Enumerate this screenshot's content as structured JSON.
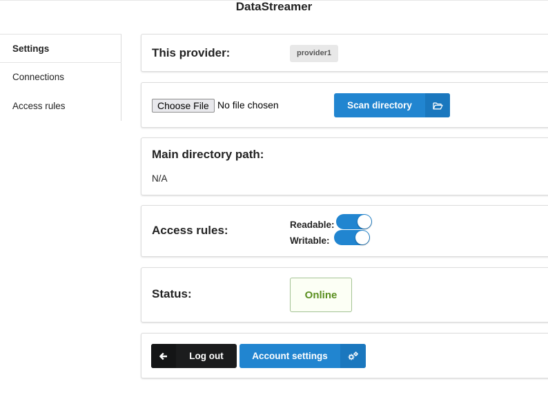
{
  "app": {
    "title": "DataStreamer"
  },
  "sidebar": {
    "items": [
      {
        "label": "Settings",
        "active": true
      },
      {
        "label": "Connections"
      },
      {
        "label": "Access rules"
      }
    ]
  },
  "provider": {
    "label": "This provider:",
    "name": "provider1"
  },
  "upload": {
    "choose_file_label": "Choose File",
    "file_status": "No file chosen",
    "scan_label": "Scan directory",
    "scan_icon": "folder-open-icon"
  },
  "directory": {
    "label": "Main directory path:",
    "value": "N/A"
  },
  "access": {
    "label": "Access rules:",
    "readable_label": "Readable:",
    "writable_label": "Writable:",
    "readable": true,
    "writable": true
  },
  "status": {
    "label": "Status:",
    "value": "Online",
    "color": "#5a8f1f"
  },
  "actions": {
    "logout_label": "Log out",
    "logout_icon": "arrow-left-icon",
    "account_label": "Account settings",
    "account_icon": "cogs-icon"
  },
  "colors": {
    "primary": "#2185d0",
    "dark": "#1b1c1d",
    "success": "#5a8f1f"
  }
}
